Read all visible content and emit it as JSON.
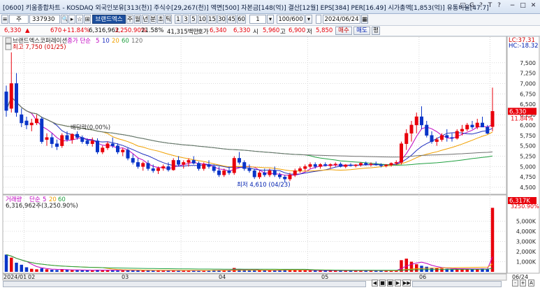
{
  "window": {
    "title": "[0600] 키움종합차트 - KOSDAQ 외국인보유[313(천)] 주식수[29,267(천)] 액면[500] 자본금[148(억)] 결산[12월] EPS[384] PER[16.49] 시가총액[1,853(억)] 유통비율[47.7]",
    "buttons": [
      "□",
      "G",
      "?",
      "T",
      "?",
      "−",
      "□",
      "✕"
    ]
  },
  "toolbar": {
    "type_label": "주",
    "code": "337930",
    "stock_name": "브랜드엑스",
    "periods": [
      "주",
      "월",
      "년",
      "분",
      "초",
      "틱"
    ],
    "minutes": [
      "1",
      "3",
      "5",
      "10",
      "15",
      "30",
      "45",
      "60"
    ],
    "count_value": "1",
    "range_value": "100/600",
    "date_value": "2024/06/24"
  },
  "quote": {
    "price": "6,330",
    "arrow": "▲",
    "change": "670",
    "change_pct": "+11.84%",
    "volume": "6,316,962",
    "vol_ratio": "3,250.90%",
    "turnover": "21.58%",
    "amount": "41,315백만",
    "ask_label": "호가",
    "ask": "6,340",
    "bid": "6,330",
    "open_label": "시",
    "open": "5,960",
    "high_label": "고",
    "high": "6,900",
    "low_label": "저",
    "low": "5,850",
    "buy_label": "매수",
    "sell_label": "매도",
    "extra_label": "평"
  },
  "chart_data": {
    "type": "candlestick",
    "title": "브랜드엑스코퍼레이션",
    "ma_label": "종가 단순",
    "ma_periods": [
      "5",
      "10",
      "20",
      "60",
      "120"
    ],
    "ma_colors": [
      "#c000c0",
      "#2030c0",
      "#f0a000",
      "#20a040",
      "#707070"
    ],
    "annotations": {
      "high": "최고 7,750 (01/25)",
      "low": "최저 4,610 (04/23)",
      "prev": "배당락(0.00%)"
    },
    "price_axis": {
      "ticks": [
        "7,500",
        "7,250",
        "7,000",
        "6,750",
        "6,500",
        "6,250",
        "6,000",
        "5,750",
        "5,500",
        "5,250",
        "5,000",
        "4,750",
        "4,500"
      ],
      "ylim": [
        4400,
        7900
      ]
    },
    "right_labels": {
      "lc": "LC:37.31",
      "hc": "HC:-18.32",
      "price": "6,330",
      "pct": "11.84%"
    },
    "x_labels": [
      "2024/01",
      "02",
      "03",
      "04",
      "05",
      "06"
    ],
    "bottom_right": "06/24",
    "candles": [
      [
        6800,
        6950,
        6200,
        6350
      ],
      [
        6400,
        7750,
        6300,
        7000
      ],
      [
        7000,
        7250,
        6200,
        6300
      ],
      [
        6250,
        6400,
        5950,
        6050
      ],
      [
        6100,
        6200,
        5900,
        6000
      ],
      [
        6000,
        6150,
        5850,
        6050
      ],
      [
        6050,
        6250,
        6000,
        6150
      ],
      [
        6150,
        6200,
        5550,
        5600
      ],
      [
        5650,
        5800,
        5500,
        5700
      ],
      [
        5700,
        5800,
        5450,
        5550
      ],
      [
        5550,
        5650,
        5400,
        5480
      ],
      [
        5500,
        5800,
        5450,
        5750
      ],
      [
        5750,
        5850,
        5600,
        5650
      ],
      [
        5650,
        5800,
        5550,
        5780
      ],
      [
        5780,
        5850,
        5650,
        5700
      ],
      [
        5700,
        5750,
        5550,
        5600
      ],
      [
        5620,
        5680,
        5500,
        5550
      ],
      [
        5550,
        5700,
        5480,
        5620
      ],
      [
        5620,
        5680,
        5300,
        5350
      ],
      [
        5350,
        5500,
        5300,
        5450
      ],
      [
        5450,
        5600,
        5400,
        5550
      ],
      [
        5550,
        5700,
        5450,
        5500
      ],
      [
        5500,
        5560,
        5300,
        5350
      ],
      [
        5350,
        5450,
        5250,
        5400
      ],
      [
        5400,
        5450,
        5150,
        5200
      ],
      [
        5200,
        5300,
        5050,
        5100
      ],
      [
        5100,
        5200,
        4950,
        5000
      ],
      [
        5000,
        5120,
        4900,
        5080
      ],
      [
        5080,
        5150,
        4900,
        4950
      ],
      [
        4950,
        5050,
        4850,
        4900
      ],
      [
        4900,
        5000,
        4820,
        4960
      ],
      [
        4960,
        5050,
        4900,
        5000
      ],
      [
        5000,
        5100,
        4880,
        4920
      ],
      [
        4920,
        5200,
        4900,
        5150
      ],
      [
        5150,
        5250,
        5000,
        5050
      ],
      [
        5050,
        5150,
        4950,
        5100
      ],
      [
        5100,
        5200,
        5000,
        5150
      ],
      [
        5150,
        5250,
        5050,
        5080
      ],
      [
        5080,
        5120,
        4900,
        4950
      ],
      [
        4950,
        5100,
        4900,
        5050
      ],
      [
        5050,
        5150,
        4950,
        5000
      ],
      [
        5000,
        5050,
        4850,
        4900
      ],
      [
        4900,
        5000,
        4750,
        4800
      ],
      [
        4800,
        4950,
        4750,
        4900
      ],
      [
        4900,
        5000,
        4800,
        4850
      ],
      [
        4850,
        5250,
        4800,
        5200
      ],
      [
        5200,
        5350,
        5050,
        5100
      ],
      [
        5100,
        5150,
        4900,
        4950
      ],
      [
        4950,
        5050,
        4850,
        4900
      ],
      [
        4900,
        4950,
        4700,
        4750
      ],
      [
        4750,
        4900,
        4700,
        4850
      ],
      [
        4850,
        4950,
        4750,
        4800
      ],
      [
        4800,
        4950,
        4750,
        4900
      ],
      [
        4900,
        5000,
        4750,
        4800
      ],
      [
        4800,
        4850,
        4700,
        4750
      ],
      [
        4750,
        4800,
        4610,
        4700
      ],
      [
        4700,
        4850,
        4650,
        4800
      ],
      [
        4800,
        4950,
        4750,
        4900
      ],
      [
        4900,
        5000,
        4850,
        4950
      ],
      [
        4950,
        5050,
        4900,
        5000
      ],
      [
        5000,
        5100,
        4950,
        5050
      ],
      [
        5050,
        5100,
        4950,
        5000
      ],
      [
        5000,
        5080,
        4950,
        5050
      ],
      [
        5050,
        5100,
        5000,
        5020
      ],
      [
        5020,
        5080,
        4950,
        5050
      ],
      [
        5050,
        5100,
        5000,
        5060
      ],
      [
        5060,
        5100,
        4980,
        5000
      ],
      [
        5000,
        5060,
        4960,
        5040
      ],
      [
        5040,
        5080,
        5000,
        5020
      ],
      [
        5020,
        5060,
        4980,
        5040
      ],
      [
        5040,
        5100,
        5000,
        5080
      ],
      [
        5080,
        5120,
        5020,
        5050
      ],
      [
        5050,
        5100,
        5000,
        5060
      ],
      [
        5060,
        5120,
        5020,
        5040
      ],
      [
        5040,
        5080,
        4980,
        5020
      ],
      [
        5020,
        5060,
        4980,
        5040
      ],
      [
        5040,
        5100,
        5000,
        5080
      ],
      [
        5080,
        5150,
        5040,
        5100
      ],
      [
        5100,
        5600,
        5050,
        5550
      ],
      [
        5550,
        5900,
        5400,
        5800
      ],
      [
        5800,
        6100,
        5600,
        6000
      ],
      [
        6000,
        6300,
        5800,
        6200
      ],
      [
        6200,
        6450,
        5900,
        6000
      ],
      [
        6000,
        6100,
        5700,
        5750
      ],
      [
        5750,
        5850,
        5550,
        5600
      ],
      [
        5600,
        5700,
        5500,
        5650
      ],
      [
        5650,
        5800,
        5600,
        5750
      ],
      [
        5750,
        5900,
        5600,
        5700
      ],
      [
        5700,
        5800,
        5600,
        5680
      ],
      [
        5680,
        5900,
        5650,
        5850
      ],
      [
        5850,
        6000,
        5750,
        5900
      ],
      [
        5900,
        6050,
        5850,
        6000
      ],
      [
        6000,
        6100,
        5900,
        5950
      ],
      [
        5950,
        6150,
        5900,
        6050
      ],
      [
        6050,
        6200,
        5950,
        5950
      ],
      [
        5950,
        6000,
        5780,
        5800
      ],
      [
        5960,
        6900,
        5850,
        6330
      ]
    ],
    "volume_label": "거래량",
    "vol_ma_label": "단순",
    "vol_ma_periods": [
      "5",
      "20",
      "60"
    ],
    "volume_axis": {
      "ticks": [
        "5,000K",
        "4,000K",
        "3,000K",
        "2,000K",
        "1,000K"
      ],
      "ylim": [
        0,
        6000
      ]
    },
    "volume_text": "6,316,962주(3,250.90%)",
    "volume_right": {
      "value": "6,317K",
      "pct": "3250.90%"
    },
    "volumes": [
      1700,
      1400,
      900,
      700,
      450,
      300,
      250,
      350,
      250,
      200,
      180,
      230,
      200,
      170,
      160,
      150,
      140,
      170,
      200,
      160,
      150,
      140,
      160,
      170,
      150,
      140,
      150,
      140,
      130,
      140,
      130,
      120,
      150,
      140,
      130,
      120,
      110,
      120,
      130,
      140,
      150,
      180,
      170,
      150,
      160,
      380,
      280,
      200,
      150,
      180,
      160,
      150,
      140,
      170,
      190,
      230,
      200,
      160,
      150,
      140,
      130,
      140,
      130,
      120,
      130,
      120,
      110,
      120,
      110,
      120,
      130,
      120,
      110,
      120,
      110,
      120,
      130,
      140,
      1150,
      1300,
      1000,
      750,
      600,
      500,
      400,
      350,
      330,
      300,
      280,
      300,
      320,
      300,
      280,
      260,
      330,
      240,
      6317
    ]
  },
  "nav": {
    "buttons": [
      "◀",
      "■",
      "■",
      "▶",
      "▶▶",
      "-",
      "+",
      "A"
    ]
  }
}
